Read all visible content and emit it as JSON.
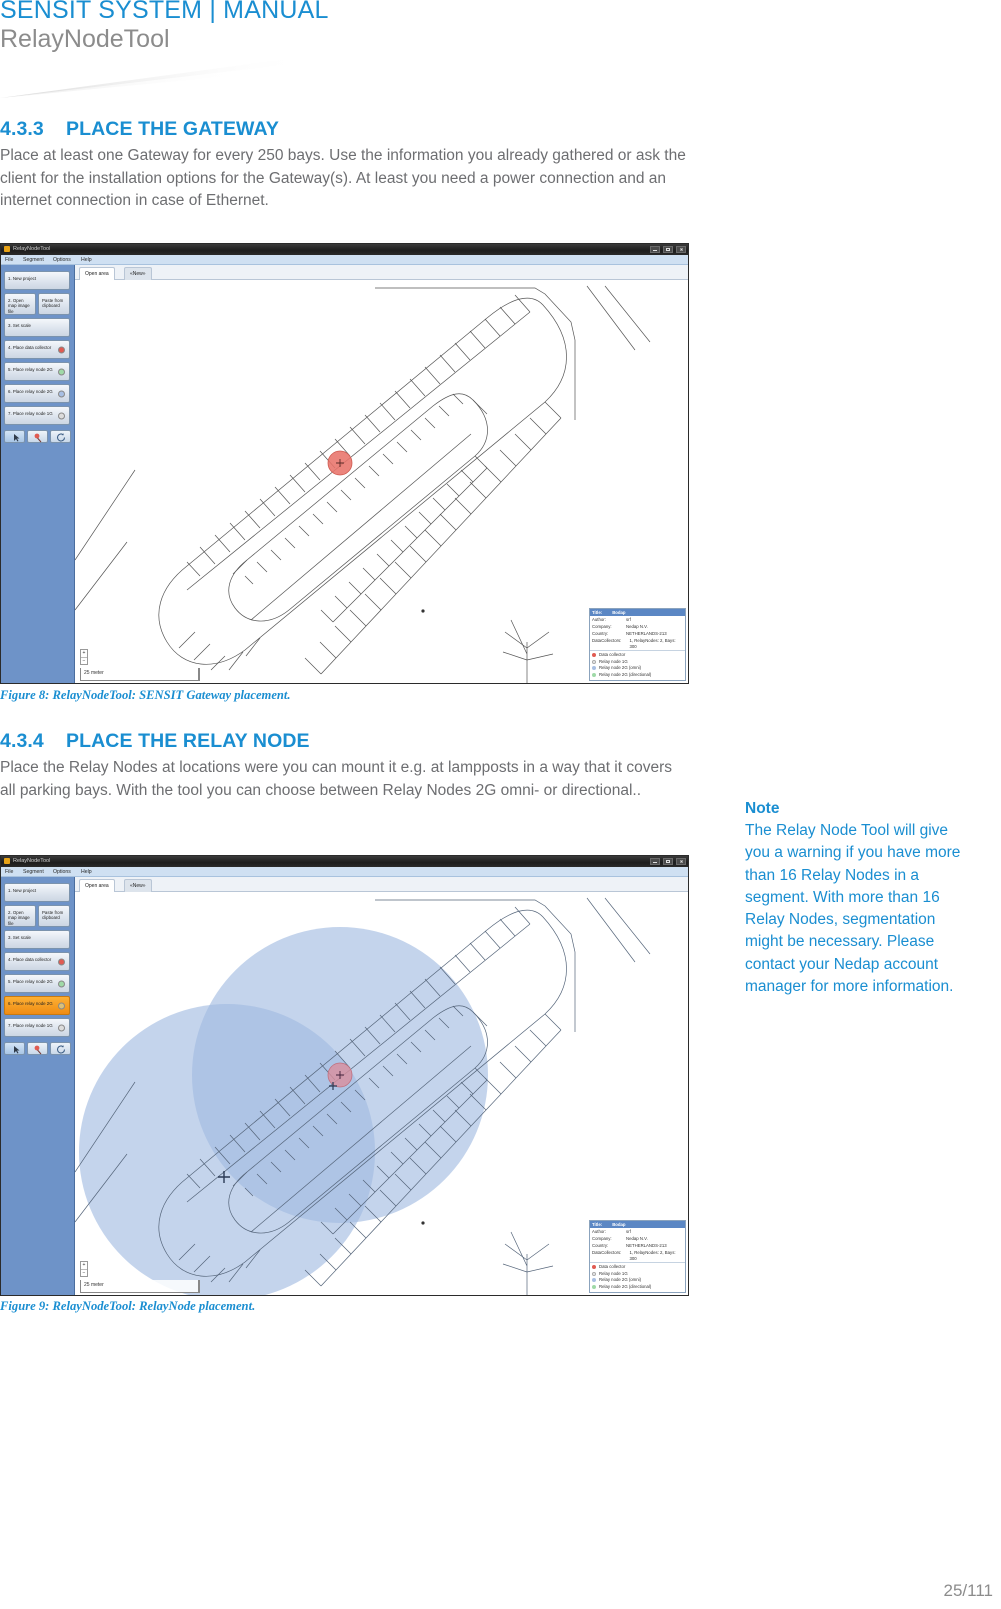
{
  "header": {
    "title": "SENSIT SYSTEM | MANUAL",
    "subtitle": "RelayNodeTool"
  },
  "sections": [
    {
      "number": "4.3.3",
      "title": "PLACE THE GATEWAY",
      "body": "Place at least one Gateway for every 250 bays. Use the information you already gathered or ask the client for the installation options for the Gateway(s). At least you need a power connection and an internet connection in case of Ethernet."
    },
    {
      "number": "4.3.4",
      "title": "PLACE THE RELAY NODE",
      "body": "Place the Relay Nodes at locations were you can mount it e.g. at lampposts in a way that it covers all parking bays. With the tool you can choose between Relay Nodes 2G omni- or directional.."
    }
  ],
  "figures": [
    {
      "caption": "Figure 8: RelayNodeTool: SENSIT Gateway placement."
    },
    {
      "caption": "Figure 9: RelayNodeTool: RelayNode placement."
    }
  ],
  "note": {
    "title": "Note",
    "body": "The Relay Node Tool will give you a warning if you have more than 16 Relay Nodes in a segment. With more than 16 Relay Nodes, segmentation might be necessary. Please contact your Nedap account manager for more information."
  },
  "footer": {
    "page": "25/111"
  },
  "app": {
    "window_title": "RelayNodeTool",
    "menu": [
      "File",
      "Segment",
      "Options",
      "Help"
    ],
    "tabs": [
      {
        "label": "Open area",
        "active": true
      },
      {
        "label": "«New»",
        "active": false
      }
    ],
    "sidebar_buttons": [
      {
        "label": "1. New project",
        "dot": null
      },
      {
        "label": "2. Open map image file",
        "dot": null
      },
      {
        "label": "Paste from clipboard",
        "dot": null
      },
      {
        "label": "3. Set scale",
        "dot": null
      },
      {
        "label": "4. Place data collector",
        "dot": "#e05b52"
      },
      {
        "label": "5. Place relay node 2G",
        "dot": "#9fd9a7"
      },
      {
        "label": "6. Place relay node 2G",
        "dot": "#a8bfe3"
      },
      {
        "label": "7. Place relay node 1G",
        "dot": "#d9d9d9"
      }
    ],
    "tools": [
      {
        "name": "select-tool"
      },
      {
        "name": "delete-pin-tool"
      },
      {
        "name": "refresh-tool"
      }
    ],
    "zoom": {
      "in": "+",
      "out": "−"
    },
    "scalebar": {
      "label": "25 meter"
    },
    "info_panel": {
      "head": {
        "col1": "Title:",
        "col2": "Bodap"
      },
      "rows": [
        {
          "k": "Author:",
          "v": "srf"
        },
        {
          "k": "Company:",
          "v": "Nedap N.V."
        },
        {
          "k": "Country:",
          "v": "NETHERLANDS-213"
        },
        {
          "k": "DataCollectors:",
          "v": "1,  RelayNodes: 2,  Bays: 300"
        }
      ],
      "legend": [
        {
          "label": "Data collector",
          "color": "#e05b52"
        },
        {
          "label": "Relay node 1G",
          "color": "#e3e3e3"
        },
        {
          "label": "Relay node 2G (omni)",
          "color": "#a8bfe3"
        },
        {
          "label": "Relay node 2G (directional)",
          "color": "#9fd9a7"
        }
      ]
    },
    "figure8": {
      "active_button_index": null,
      "markers": [
        "gateway"
      ]
    },
    "figure9": {
      "active_button_index": 6,
      "markers": [
        "gateway",
        "relay-node-a",
        "relay-node-b"
      ]
    }
  },
  "colors": {
    "brand_blue": "#1a8ed1",
    "body_gray": "#6d6e71",
    "gateway_red": "#e8736a",
    "coverage_blue": "#9fb9e0",
    "sidebar_blue": "#6e93c8",
    "active_orange": "#f5a623"
  }
}
